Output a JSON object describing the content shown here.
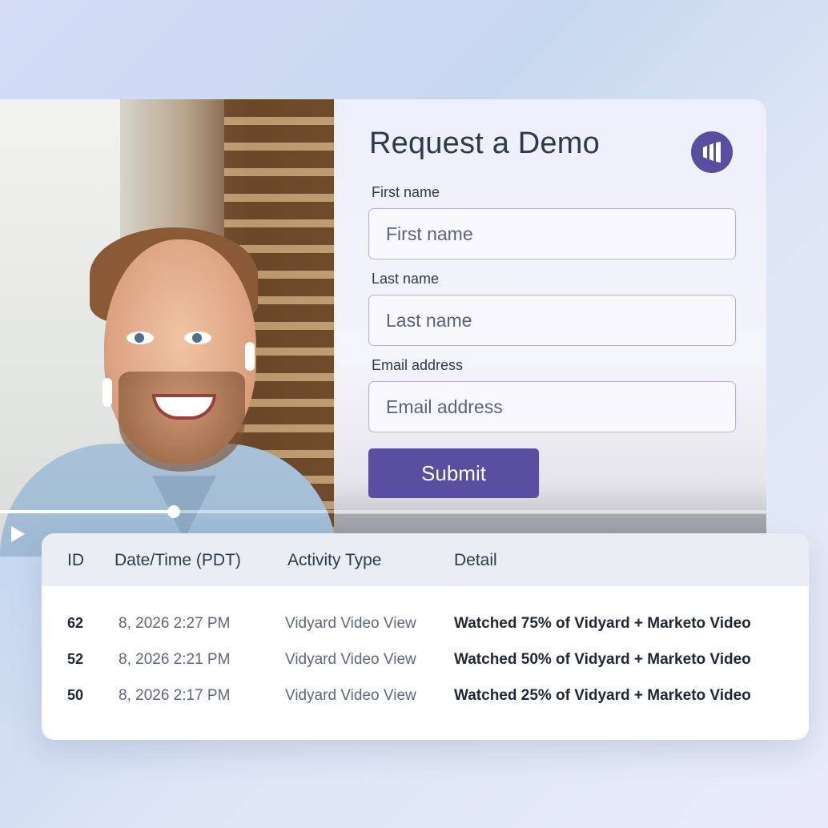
{
  "form": {
    "title": "Request a Demo",
    "brand_icon": "marketo-logo-icon",
    "fields": [
      {
        "label": "First name",
        "placeholder": "First name"
      },
      {
        "label": "Last name",
        "placeholder": "Last name"
      },
      {
        "label": "Email address",
        "placeholder": "Email address"
      }
    ],
    "submit_label": "Submit"
  },
  "player": {
    "progress_fraction": 0.227,
    "play_icon": "play-icon"
  },
  "activity_table": {
    "headers": [
      "ID",
      "Date/Time (PDT)",
      "Activity Type",
      "Detail"
    ],
    "rows": [
      {
        "id": "62",
        "datetime": "8, 2026 2:27 PM",
        "type": "Vidyard Video View",
        "detail": "Watched 75% of Vidyard + Marketo Video"
      },
      {
        "id": "52",
        "datetime": "8, 2026 2:21 PM",
        "type": "Vidyard Video View",
        "detail": "Watched 50% of Vidyard + Marketo Video"
      },
      {
        "id": "50",
        "datetime": "8, 2026 2:17 PM",
        "type": "Vidyard Video View",
        "detail": "Watched 25% of Vidyard + Marketo Video"
      }
    ]
  },
  "colors": {
    "accent": "#5a4ea0",
    "input_border": "#b3b0e8",
    "heading_text": "#2c3a4f"
  }
}
